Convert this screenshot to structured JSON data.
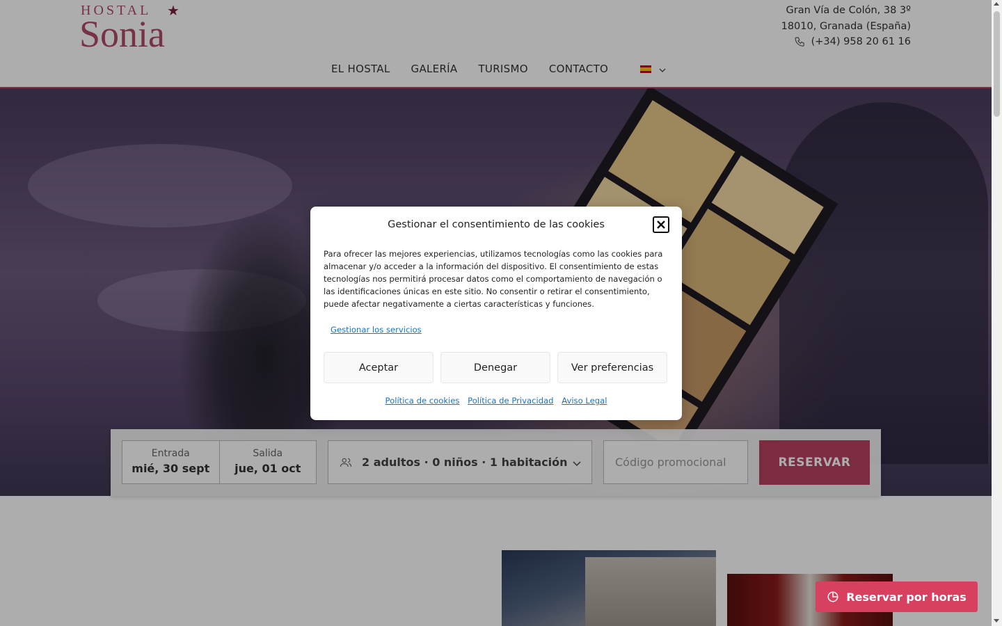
{
  "header": {
    "logo_top": "HOSTAL",
    "logo_bottom": "Sonia",
    "address_line1": "Gran Vía de Colón, 38 3º",
    "address_line2": "18010, Granada (España)",
    "phone": "(+34)  958 20 61 16",
    "nav": [
      "EL HOSTAL",
      "GALERÍA",
      "TURISMO",
      "CONTACTO"
    ],
    "language": "es",
    "colors": {
      "brand": "#b04a66",
      "border": "#b44a64"
    }
  },
  "booking": {
    "checkin_label": "Entrada",
    "checkin_value": "mié, 30 sept",
    "checkout_label": "Salida",
    "checkout_value": "jue, 01 oct",
    "guests": "2 adultos · 0 niños · 1 habitación",
    "promo_placeholder": "Código promocional",
    "submit": "RESERVAR",
    "submit_color": "#b5425f"
  },
  "floating": {
    "hours_button": "Reservar por horas",
    "color": "#d7415f"
  },
  "cookie_modal": {
    "title": "Gestionar el consentimiento de las cookies",
    "body": "Para ofrecer las mejores experiencias, utilizamos tecnologías como las cookies para almacenar y/o acceder a la información del dispositivo. El consentimiento de estas tecnologías nos permitirá procesar datos como el comportamiento de navegación o las identificaciones únicas en este sitio. No consentir o retirar el consentimiento, puede afectar negativamente a ciertas características y funciones.",
    "manage_services": "Gestionar los servicios",
    "accept": "Aceptar",
    "deny": "Denegar",
    "preferences": "Ver preferencias",
    "links": [
      "Política de cookies",
      "Política de Privacidad",
      "Aviso Legal"
    ]
  }
}
